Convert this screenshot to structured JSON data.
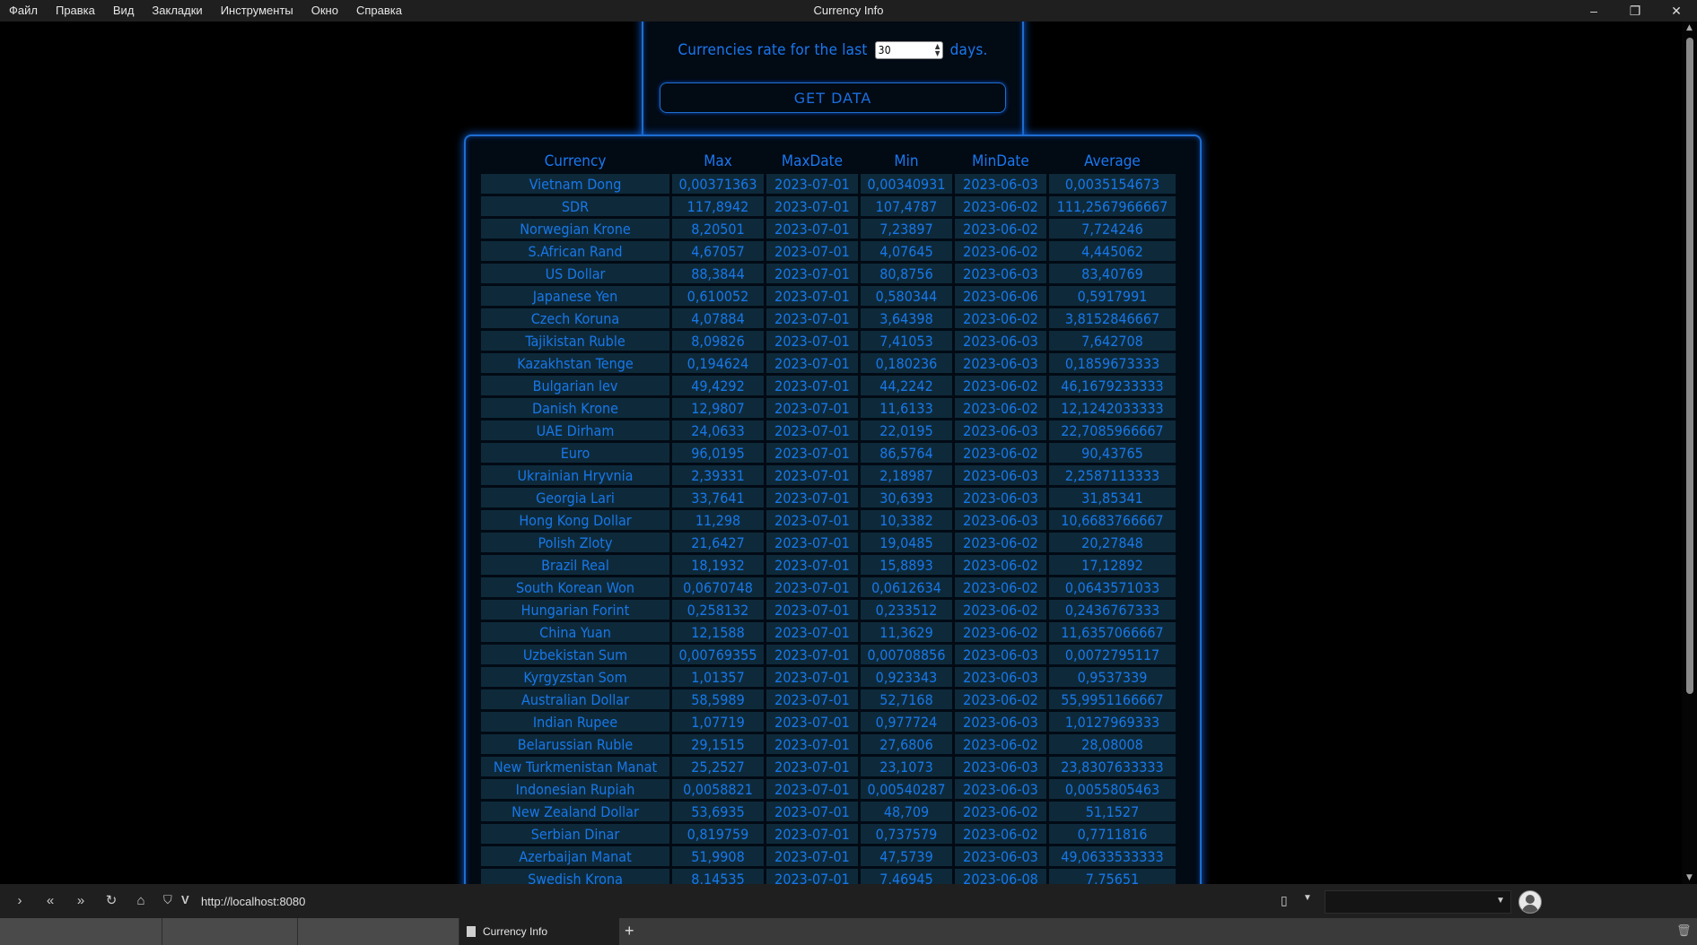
{
  "window": {
    "title": "Currency Info",
    "menu": [
      "Файл",
      "Правка",
      "Вид",
      "Закладки",
      "Инструменты",
      "Окно",
      "Справка"
    ],
    "controls": {
      "minimize": "–",
      "restore": "❐",
      "close": "✕"
    }
  },
  "controls": {
    "rate_prefix": "Currencies rate for the last",
    "days_value": "30",
    "rate_suffix": "days.",
    "get_data_label": "GET DATA"
  },
  "table": {
    "headers": [
      "Currency",
      "Max",
      "MaxDate",
      "Min",
      "MinDate",
      "Average"
    ],
    "rows": [
      [
        "Vietnam Dong",
        "0,00371363",
        "2023-07-01",
        "0,00340931",
        "2023-06-03",
        "0,0035154673"
      ],
      [
        "SDR",
        "117,8942",
        "2023-07-01",
        "107,4787",
        "2023-06-02",
        "111,2567966667"
      ],
      [
        "Norwegian Krone",
        "8,20501",
        "2023-07-01",
        "7,23897",
        "2023-06-02",
        "7,724246"
      ],
      [
        "S.African Rand",
        "4,67057",
        "2023-07-01",
        "4,07645",
        "2023-06-02",
        "4,445062"
      ],
      [
        "US Dollar",
        "88,3844",
        "2023-07-01",
        "80,8756",
        "2023-06-03",
        "83,40769"
      ],
      [
        "Japanese Yen",
        "0,610052",
        "2023-07-01",
        "0,580344",
        "2023-06-06",
        "0,5917991"
      ],
      [
        "Czech Koruna",
        "4,07884",
        "2023-07-01",
        "3,64398",
        "2023-06-02",
        "3,8152846667"
      ],
      [
        "Tajikistan Ruble",
        "8,09826",
        "2023-07-01",
        "7,41053",
        "2023-06-03",
        "7,642708"
      ],
      [
        "Kazakhstan Tenge",
        "0,194624",
        "2023-07-01",
        "0,180236",
        "2023-06-03",
        "0,1859673333"
      ],
      [
        "Bulgarian lev",
        "49,4292",
        "2023-07-01",
        "44,2242",
        "2023-06-02",
        "46,1679233333"
      ],
      [
        "Danish Krone",
        "12,9807",
        "2023-07-01",
        "11,6133",
        "2023-06-02",
        "12,1242033333"
      ],
      [
        "UAE Dirham",
        "24,0633",
        "2023-07-01",
        "22,0195",
        "2023-06-03",
        "22,7085966667"
      ],
      [
        "Euro",
        "96,0195",
        "2023-07-01",
        "86,5764",
        "2023-06-02",
        "90,43765"
      ],
      [
        "Ukrainian Hryvnia",
        "2,39331",
        "2023-07-01",
        "2,18987",
        "2023-06-03",
        "2,2587113333"
      ],
      [
        "Georgia Lari",
        "33,7641",
        "2023-07-01",
        "30,6393",
        "2023-06-03",
        "31,85341"
      ],
      [
        "Hong Kong Dollar",
        "11,298",
        "2023-07-01",
        "10,3382",
        "2023-06-03",
        "10,6683766667"
      ],
      [
        "Polish Zloty",
        "21,6427",
        "2023-07-01",
        "19,0485",
        "2023-06-02",
        "20,27848"
      ],
      [
        "Brazil Real",
        "18,1932",
        "2023-07-01",
        "15,8893",
        "2023-06-02",
        "17,12892"
      ],
      [
        "South Korean Won",
        "0,0670748",
        "2023-07-01",
        "0,0612634",
        "2023-06-02",
        "0,0643571033"
      ],
      [
        "Hungarian Forint",
        "0,258132",
        "2023-07-01",
        "0,233512",
        "2023-06-02",
        "0,2436767333"
      ],
      [
        "China Yuan",
        "12,1588",
        "2023-07-01",
        "11,3629",
        "2023-06-02",
        "11,6357066667"
      ],
      [
        "Uzbekistan Sum",
        "0,00769355",
        "2023-07-01",
        "0,00708856",
        "2023-06-03",
        "0,0072795117"
      ],
      [
        "Kyrgyzstan Som",
        "1,01357",
        "2023-07-01",
        "0,923343",
        "2023-06-03",
        "0,9537339"
      ],
      [
        "Australian Dollar",
        "58,5989",
        "2023-07-01",
        "52,7168",
        "2023-06-02",
        "55,9951166667"
      ],
      [
        "Indian Rupee",
        "1,07719",
        "2023-07-01",
        "0,977724",
        "2023-06-03",
        "1,0127969333"
      ],
      [
        "Belarussian Ruble",
        "29,1515",
        "2023-07-01",
        "27,6806",
        "2023-06-02",
        "28,08008"
      ],
      [
        "New Turkmenistan Manat",
        "25,2527",
        "2023-07-01",
        "23,1073",
        "2023-06-03",
        "23,8307633333"
      ],
      [
        "Indonesian Rupiah",
        "0,0058821",
        "2023-07-01",
        "0,00540287",
        "2023-06-03",
        "0,0055805463"
      ],
      [
        "New Zealand Dollar",
        "53,6935",
        "2023-07-01",
        "48,709",
        "2023-06-02",
        "51,1527"
      ],
      [
        "Serbian Dinar",
        "0,819759",
        "2023-07-01",
        "0,737579",
        "2023-06-02",
        "0,7711816"
      ],
      [
        "Azerbaijan Manat",
        "51,9908",
        "2023-07-01",
        "47,5739",
        "2023-06-03",
        "49,0633533333"
      ],
      [
        "Swedish Krona",
        "8,14535",
        "2023-07-01",
        "7,46945",
        "2023-06-08",
        "7,75651"
      ]
    ]
  },
  "nav": {
    "url": "http://localhost:8080",
    "icons": [
      "forward-panel-icon",
      "rewind-icon",
      "fast-forward-icon",
      "reload-icon",
      "home-icon",
      "shield-icon",
      "v-icon",
      "bookmark-icon",
      "profile-icon"
    ]
  },
  "tabs": {
    "active_label": "Currency Info"
  },
  "colors": {
    "accent": "#1a78ef",
    "panel_border": "#1e6dd0",
    "row_bg": "#0e2a3a",
    "background": "#000000"
  }
}
